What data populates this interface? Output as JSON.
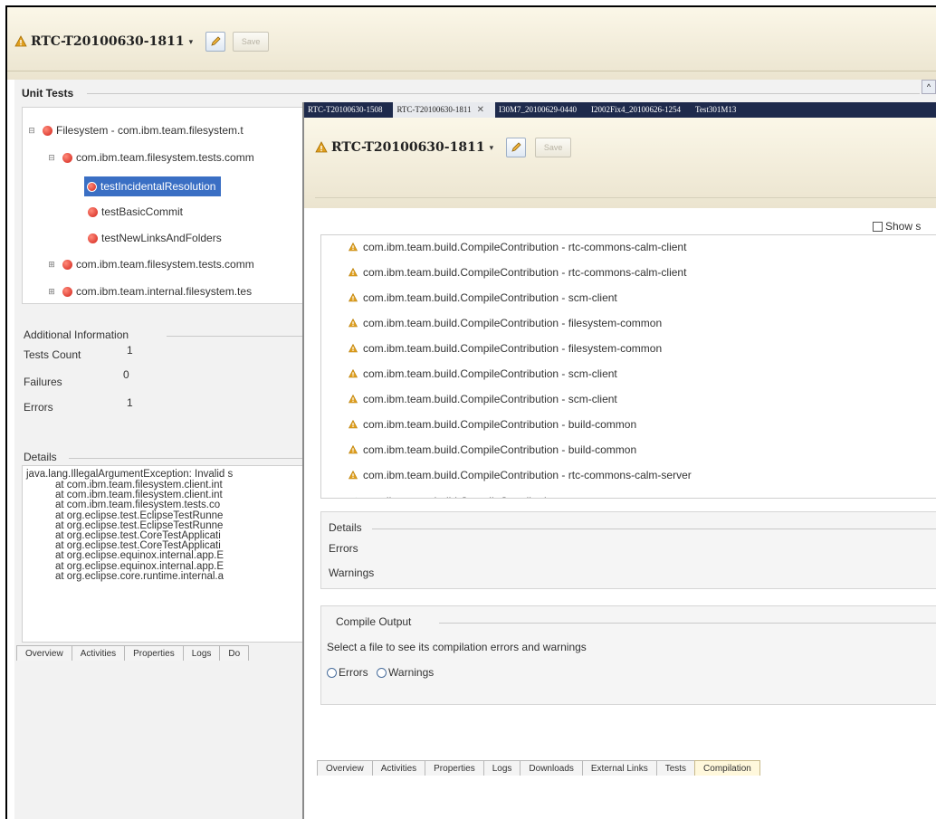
{
  "back_window": {
    "title": "RTC-T20100630-1811",
    "save_label": "Save",
    "section_title": "Unit Tests",
    "tree": [
      {
        "level": 0,
        "expander": "⊟",
        "label": "Filesystem - com.ibm.team.filesystem.t"
      },
      {
        "level": 1,
        "expander": "⊟",
        "label": "com.ibm.team.filesystem.tests.comm"
      },
      {
        "level": 2,
        "expander": "",
        "label": "testIncidentalResolution",
        "selected": true
      },
      {
        "level": 2,
        "expander": "",
        "label": "testBasicCommit"
      },
      {
        "level": 2,
        "expander": "",
        "label": "testNewLinksAndFolders"
      },
      {
        "level": 1,
        "expander": "⊞",
        "label": "com.ibm.team.filesystem.tests.comm"
      },
      {
        "level": 1,
        "expander": "⊞",
        "label": "com.ibm.team.internal.filesystem.tes"
      }
    ],
    "additional_info": {
      "title": "Additional Information",
      "rows": [
        {
          "label": "Tests Count",
          "value": "1"
        },
        {
          "label": "Failures",
          "value": "0"
        },
        {
          "label": "Errors",
          "value": "1"
        }
      ]
    },
    "details": {
      "title": "Details",
      "first_line": "java.lang.IllegalArgumentException: Invalid s",
      "stack": [
        "at com.ibm.team.filesystem.client.int",
        "at com.ibm.team.filesystem.client.int",
        "at com.ibm.team.filesystem.tests.co",
        "at org.eclipse.test.EclipseTestRunne",
        "at org.eclipse.test.EclipseTestRunne",
        "at org.eclipse.test.CoreTestApplicati",
        "at org.eclipse.test.CoreTestApplicati",
        "at org.eclipse.equinox.internal.app.E",
        "at org.eclipse.equinox.internal.app.E",
        "at org.eclipse.core.runtime.internal.a"
      ]
    },
    "tabs": [
      "Overview",
      "Activities",
      "Properties",
      "Logs",
      "Do"
    ]
  },
  "front_window": {
    "editor_tabs": [
      {
        "label": "RTC-T20100630-1508",
        "active": false,
        "close": ""
      },
      {
        "label": "RTC-T20100630-1811",
        "active": true,
        "close": "✕"
      },
      {
        "label": "I30M7_20100629-0440",
        "active": false,
        "close": ""
      },
      {
        "label": "I2002Fix4_20100626-1254",
        "active": false,
        "close": ""
      },
      {
        "label": "Test301M13",
        "active": false,
        "close": ""
      }
    ],
    "title": "RTC-T20100630-1811",
    "save_label": "Save",
    "show_checkbox_label": "Show s",
    "contributions": [
      {
        "status": "warning",
        "label": "com.ibm.team.build.CompileContribution - rtc-commons-calm-client"
      },
      {
        "status": "warning",
        "label": "com.ibm.team.build.CompileContribution - rtc-commons-calm-client"
      },
      {
        "status": "warning",
        "label": "com.ibm.team.build.CompileContribution - scm-client"
      },
      {
        "status": "warning",
        "label": "com.ibm.team.build.CompileContribution - filesystem-common"
      },
      {
        "status": "warning",
        "label": "com.ibm.team.build.CompileContribution - filesystem-common"
      },
      {
        "status": "warning",
        "label": "com.ibm.team.build.CompileContribution - scm-client"
      },
      {
        "status": "warning",
        "label": "com.ibm.team.build.CompileContribution - scm-client"
      },
      {
        "status": "warning",
        "label": "com.ibm.team.build.CompileContribution - build-common"
      },
      {
        "status": "warning",
        "label": "com.ibm.team.build.CompileContribution - build-common"
      },
      {
        "status": "warning",
        "label": "com.ibm.team.build.CompileContribution - rtc-commons-calm-server"
      },
      {
        "status": "ok",
        "label": "com.ibm.team.build.CompileContribution - teamz-common"
      }
    ],
    "details": {
      "title": "Details",
      "errors_label": "Errors",
      "warnings_label": "Warnings"
    },
    "compile_output": {
      "title": "Compile Output",
      "hint": "Select a file to see its compilation errors and warnings",
      "radio_errors": "Errors",
      "radio_warnings": "Warnings"
    },
    "tabs": [
      {
        "label": "Overview",
        "active": false
      },
      {
        "label": "Activities",
        "active": false
      },
      {
        "label": "Properties",
        "active": false
      },
      {
        "label": "Logs",
        "active": false
      },
      {
        "label": "Downloads",
        "active": false
      },
      {
        "label": "External Links",
        "active": false
      },
      {
        "label": "Tests",
        "active": false
      },
      {
        "label": "Compilation",
        "active": true
      }
    ]
  },
  "colors": {
    "selection": "#3a6fc4",
    "editor_tab_bar": "#1e2a4c",
    "active_tab": "#fff8dc",
    "error": "#d2231a",
    "warning": "#e0a020",
    "ok": "#2e8b3e"
  }
}
